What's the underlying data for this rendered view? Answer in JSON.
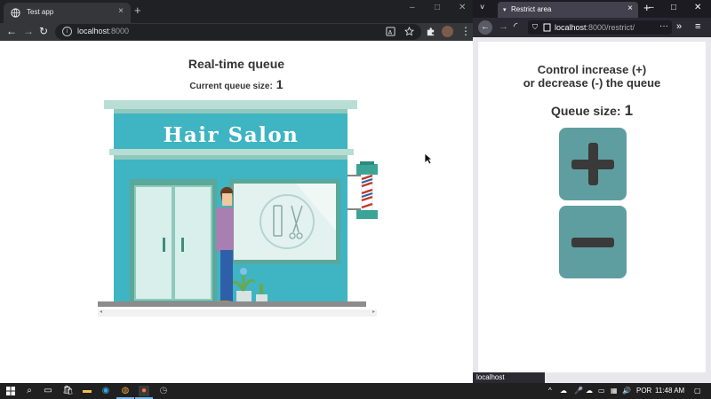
{
  "chrome": {
    "tab_title": "Test app",
    "tab_close": "×",
    "new_tab": "+",
    "window_controls": [
      "–",
      "□",
      "✕"
    ],
    "url_host": "localhost",
    "url_port": ":8000",
    "nav": {
      "back": "←",
      "forward": "→",
      "reload": "↻"
    },
    "toolbar_icons": [
      "translate-icon",
      "star-icon",
      "extensions-icon",
      "avatar",
      "menu-icon"
    ]
  },
  "app": {
    "heading": "Real-time queue",
    "queue_label": "Current queue size:",
    "queue_value": "1",
    "sign_text": "Hair Salon",
    "scroll_left": "◂",
    "scroll_right": "▸"
  },
  "firefox": {
    "tab_title": "Restrict area",
    "tab_close": "×",
    "new_tab": "+",
    "window_controls": [
      "–",
      "□",
      "✕"
    ],
    "url_host": "localhost",
    "url_path": ":8000/restrict/",
    "url_more": "···",
    "status_text": "localhost"
  },
  "restrict": {
    "control_line1": "Control increase (+)",
    "control_line2": "or decrease (-) the queue",
    "queue_label": "Queue size:",
    "queue_value": "1"
  },
  "taskbar": {
    "lang": "POR",
    "time": "11:48 AM"
  },
  "colors": {
    "salon_teal": "#3fb4c2",
    "button_teal": "#5f9ea0",
    "chrome_dark": "#202124",
    "firefox_dark": "#2b2a33"
  }
}
